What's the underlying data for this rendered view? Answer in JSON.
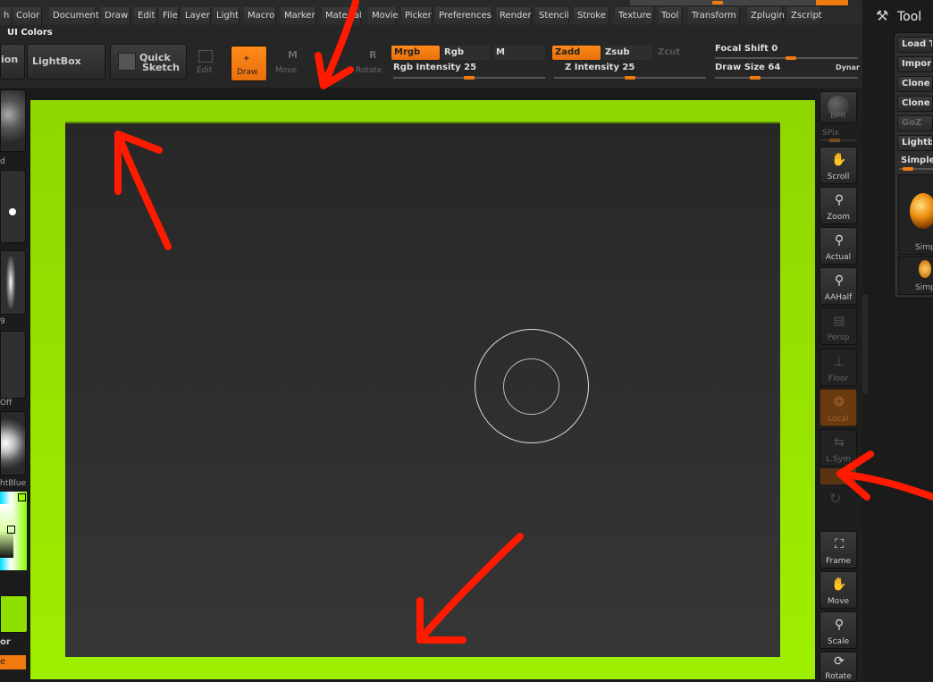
{
  "menu": {
    "items": [
      "h",
      "Color",
      "Document",
      "Draw",
      "Edit",
      "File",
      "Layer",
      "Light",
      "Macro",
      "Marker",
      "Material",
      "Movie",
      "Picker",
      "Preferences",
      "Render",
      "Stencil",
      "Stroke",
      "Texture",
      "Tool",
      "Transform",
      "Zplugin",
      "Zscript"
    ]
  },
  "shelf": {
    "title": "UI Colors",
    "partial_button": "ion",
    "lightbox": "LightBox",
    "quick_sketch_1": "Quick",
    "quick_sketch_2": "Sketch",
    "edit": "Edit",
    "draw": "Draw",
    "move": "Move",
    "move_key": "M",
    "rotate": "Rotate",
    "rotate_key": "R",
    "mrgb": "Mrgb",
    "rgb": "Rgb",
    "m": "M",
    "rgb_intensity": "Rgb Intensity 25",
    "zadd": "Zadd",
    "zsub": "Zsub",
    "zcut": "Zcut",
    "z_intensity": "Z Intensity 25",
    "focal_shift": "Focal Shift 0",
    "draw_size": "Draw Size 64",
    "dynamic": "Dynar"
  },
  "left_tray": {
    "label_d": "d",
    "label_9": "9",
    "label_off": "Off",
    "label_blue": "htBlue",
    "label_or": "or",
    "label_e": "e"
  },
  "nav": {
    "bpr": "BPR",
    "spix": "SPix",
    "scroll": "Scroll",
    "zoom": "Zoom",
    "actual": "Actual",
    "aahalf": "AAHalf",
    "persp": "Persp",
    "floor": "Floor",
    "local": "Local",
    "lsym": "L.Sym",
    "frame": "Frame",
    "move": "Move",
    "scale": "Scale",
    "rotate": "Rotate"
  },
  "tool_panel": {
    "title": "Tool",
    "load": "Load T",
    "import": "Impor",
    "clone1": "Clone",
    "clone2": "Clone",
    "goz": "GoZ",
    "lightbox": "Lightb",
    "simple": "Simple",
    "thumb1": "Simp",
    "thumb2": "Simp"
  },
  "colors": {
    "accent": "#f07a10",
    "background_green": "#9aea00",
    "annotation_red": "#ff1a00"
  }
}
